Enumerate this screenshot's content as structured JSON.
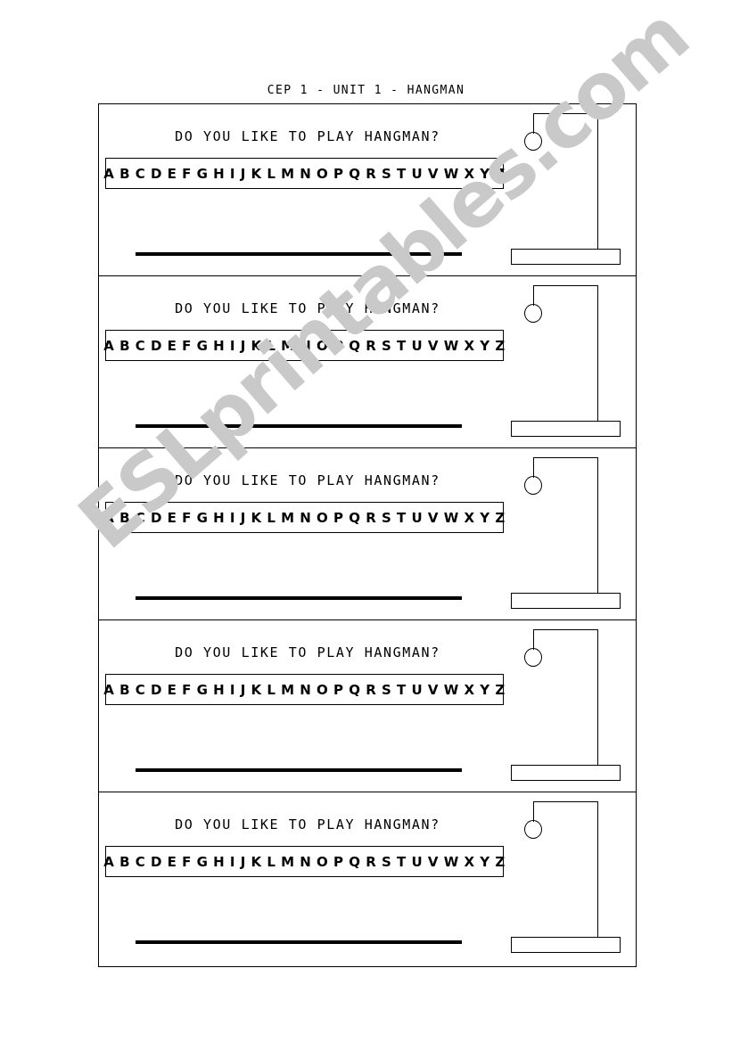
{
  "document": {
    "title": "CEP 1 - UNIT 1 - HANGMAN",
    "background_color": "#ffffff",
    "ink_color": "#000000"
  },
  "watermark": {
    "text": "ESLprintables.com",
    "color": "#c9c9c9",
    "rotation_degrees": -41
  },
  "worksheet": {
    "panel_count": 5,
    "panels": [
      {
        "question": "DO YOU LIKE TO PLAY HANGMAN?",
        "alphabet": "A B C D E F G H I J K L M N O P Q R S T U V W X Y Z",
        "answer_blank": "",
        "gallows": {
          "head_drawn": true,
          "body_drawn": false,
          "arms_drawn": false,
          "legs_drawn": false
        }
      },
      {
        "question": "DO YOU LIKE TO PLAY HANGMAN?",
        "alphabet": "A B C D E F G H I J K L M N O P Q R S T U V W X Y Z",
        "answer_blank": "",
        "gallows": {
          "head_drawn": true,
          "body_drawn": false,
          "arms_drawn": false,
          "legs_drawn": false
        }
      },
      {
        "question": "DO YOU LIKE TO PLAY HANGMAN?",
        "alphabet": "A B C D E F G H I J K L M N O P Q R S T U V W X Y Z",
        "answer_blank": "",
        "gallows": {
          "head_drawn": true,
          "body_drawn": false,
          "arms_drawn": false,
          "legs_drawn": false
        }
      },
      {
        "question": "DO YOU LIKE TO PLAY HANGMAN?",
        "alphabet": "A B C D E F G H I J K L M N O P Q R S T U V W X Y Z",
        "answer_blank": "",
        "gallows": {
          "head_drawn": true,
          "body_drawn": false,
          "arms_drawn": false,
          "legs_drawn": false
        }
      },
      {
        "question": "DO YOU LIKE TO PLAY HANGMAN?",
        "alphabet": "A B C D E F G H I J K L M N O P Q R S T U V W X Y Z",
        "answer_blank": "",
        "gallows": {
          "head_drawn": true,
          "body_drawn": false,
          "arms_drawn": false,
          "legs_drawn": false
        }
      }
    ]
  }
}
